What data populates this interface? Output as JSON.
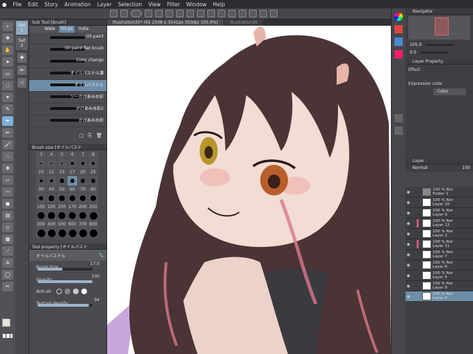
{
  "menu": [
    "File",
    "Edit",
    "Story",
    "Animation",
    "Layer",
    "Selection",
    "View",
    "Filter",
    "Window",
    "Help"
  ],
  "subtool": {
    "header": "Sub Tool [Brush]",
    "tabs": [
      "Wate",
      "Oil pa",
      "India"
    ],
    "sets": [
      "Set 1",
      "Set 2"
    ],
    "brushes": [
      {
        "label": "Oil paint",
        "selected": false
      },
      {
        "label": "Oil paint flat brush",
        "selected": false
      },
      {
        "label": "Color change",
        "selected": false
      },
      {
        "label": "オイルパステル濃",
        "selected": false
      },
      {
        "label": "オイルパステル",
        "selected": true
      },
      {
        "label": "ソーかけあみ水彩",
        "selected": false
      },
      {
        "label": "かけあみ水彩2",
        "selected": false
      },
      {
        "label": "かけあみ水彩",
        "selected": false
      }
    ]
  },
  "brush_size": {
    "header": "Brush size [オイルパステ",
    "sizes": [
      "3",
      "4",
      "5",
      "6",
      "7",
      "8",
      "10",
      "12",
      "15",
      "17",
      "20",
      "25",
      "30",
      "40",
      "50",
      "60",
      "70",
      "80",
      "100",
      "120",
      "150",
      "170",
      "200",
      "250",
      "300",
      "400",
      "500",
      "600",
      "700",
      "800"
    ],
    "selected": "17"
  },
  "tool_property": {
    "header": "Tool property [オイルパステ",
    "name": "オイルパステル",
    "brush_size_label": "Brush Size",
    "brush_size_value": "17.0",
    "opacity_label": "Opacity",
    "opacity_value": "100",
    "opacity_fraction": 1.0,
    "brush_size_fraction": 0.45,
    "antialias_label": "Anti-ali",
    "texture_label": "Texture density",
    "texture_value": "94",
    "texture_fraction": 0.94
  },
  "canvas": {
    "tabs": [
      "Illustration35* (65 2508 x 3541px 350dpi 105.0%)",
      "Illustration36"
    ],
    "active_tab": 0
  },
  "navigator": {
    "header": "Navigator",
    "zoom": "105.0",
    "rotation": "0.0"
  },
  "layer_property": {
    "header": "Layer Property",
    "effect_label": "Effect",
    "expression_label": "Expression color",
    "expression_value": "Color"
  },
  "layers": {
    "header": "Layer",
    "blend_mode": "Normal",
    "opacity": "100",
    "items": [
      {
        "pct": "100 % Nor",
        "name": "Folder 1",
        "folder": true,
        "marked": false,
        "selected": false
      },
      {
        "pct": "100 % Nor",
        "name": "Layer 10",
        "folder": false,
        "marked": false,
        "selected": false
      },
      {
        "pct": "100 % Nor",
        "name": "Layer 9",
        "folder": false,
        "marked": false,
        "selected": false
      },
      {
        "pct": "100 % Nor",
        "name": "Layer 12",
        "folder": false,
        "marked": true,
        "selected": false
      },
      {
        "pct": "100 % Nor",
        "name": "Layer 2",
        "folder": false,
        "marked": false,
        "selected": false
      },
      {
        "pct": "100 % Nor",
        "name": "Layer 11",
        "folder": false,
        "marked": true,
        "selected": false
      },
      {
        "pct": "100 % Nor",
        "name": "Layer 7",
        "folder": false,
        "marked": false,
        "selected": false
      },
      {
        "pct": "100 % Nor",
        "name": "Layer 6",
        "folder": false,
        "marked": false,
        "selected": false
      },
      {
        "pct": "100 % Nor",
        "name": "Layer 5",
        "folder": false,
        "marked": false,
        "selected": false
      },
      {
        "pct": "100 % Nor",
        "name": "Layer 8",
        "folder": false,
        "marked": false,
        "selected": false
      },
      {
        "pct": "100 % Nor",
        "name": "Layer 4",
        "folder": false,
        "marked": false,
        "selected": true
      }
    ]
  },
  "colors": {
    "accent": "#6e8ea8",
    "panel": "#4a4b50",
    "dark": "#2b2c2f",
    "hair": "#4b3436",
    "skin": "#f2dcd3",
    "pink_streak": "#d9788a"
  }
}
